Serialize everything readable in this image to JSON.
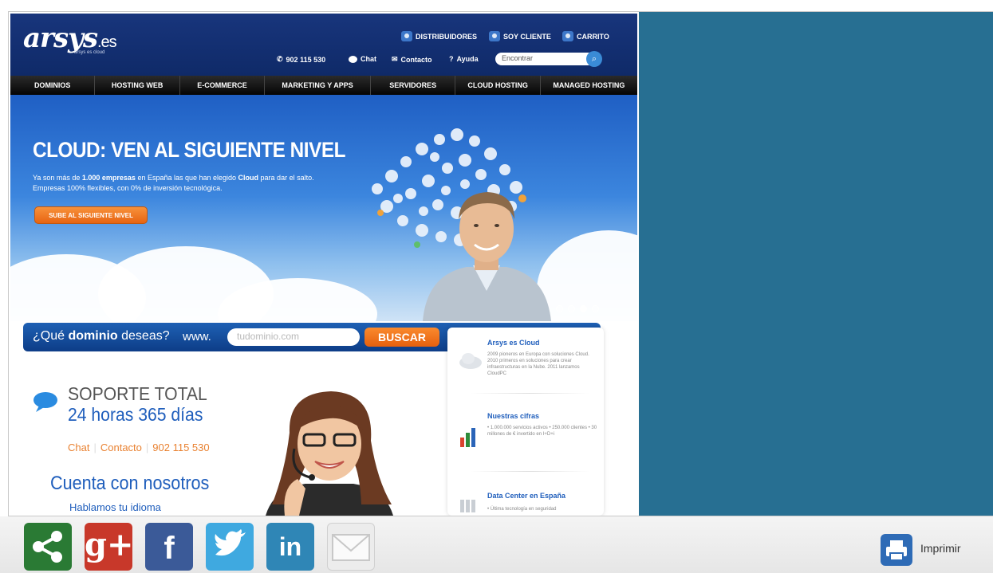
{
  "header": {
    "logo": "arsys",
    "logo_suffix": ".es",
    "logo_tagline": "arsys es cloud",
    "top_links": [
      "DISTRIBUIDORES",
      "SOY CLIENTE",
      "CARRITO"
    ],
    "phone": "902 115 530",
    "chat": "Chat",
    "contacto": "Contacto",
    "ayuda": "Ayuda",
    "search_placeholder": "Encontrar"
  },
  "nav": [
    "DOMINIOS",
    "HOSTING WEB",
    "E-COMMERCE",
    "MARKETING Y APPS",
    "SERVIDORES",
    "CLOUD HOSTING",
    "MANAGED HOSTING"
  ],
  "hero": {
    "title": "CLOUD: VEN AL SIGUIENTE NIVEL",
    "text_1": "Ya son más de ",
    "text_bold_1": "1.000 empresas",
    "text_2": " en España las que han elegido ",
    "text_bold_2": "Cloud",
    "text_3": " para dar el salto. Empresas 100% flexibles, con 0% de inversión tecnológica.",
    "button": "SUBE AL SIGUIENTE NIVEL"
  },
  "domain": {
    "question_1": "¿Qué ",
    "question_bold": "dominio",
    "question_2": " deseas?",
    "www": "www.",
    "placeholder": "tudominio.com",
    "button": "BUSCAR"
  },
  "support": {
    "title": "SOPORTE TOTAL",
    "hours": "24 horas 365 días",
    "link_chat": "Chat",
    "link_contacto": "Contacto",
    "link_phone": "902 115 530",
    "cuenta": "Cuenta con nosotros",
    "idioma": "Hablamos tu idioma"
  },
  "info": [
    {
      "title": "Arsys es Cloud",
      "text": "2009 pioneros en Europa con soluciones Cloud. 2010 primeros en soluciones para crear infraestructuras en la Nube. 2011 lanzamos CloudPC"
    },
    {
      "title": "Nuestras cifras",
      "text": "• 1.000.000 servicios activos • 250.000 clientes • 30 millones de € invertido en I+D+i"
    },
    {
      "title": "Data Center en España",
      "text": "• Última tecnología en seguridad"
    }
  ],
  "share": {
    "icons": [
      "share-icon",
      "google-plus-icon",
      "facebook-icon",
      "twitter-icon",
      "linkedin-icon",
      "mail-icon"
    ],
    "gplus_label": "g+",
    "facebook_label": "f",
    "linkedin_label": "in",
    "print_label": "Imprimir"
  },
  "colors": {
    "panel": "#276f92",
    "share": "#2a7a34",
    "gplus": "#c8382a",
    "facebook": "#3b5a98",
    "twitter": "#3fa9e0",
    "linkedin": "#2f86b6"
  }
}
